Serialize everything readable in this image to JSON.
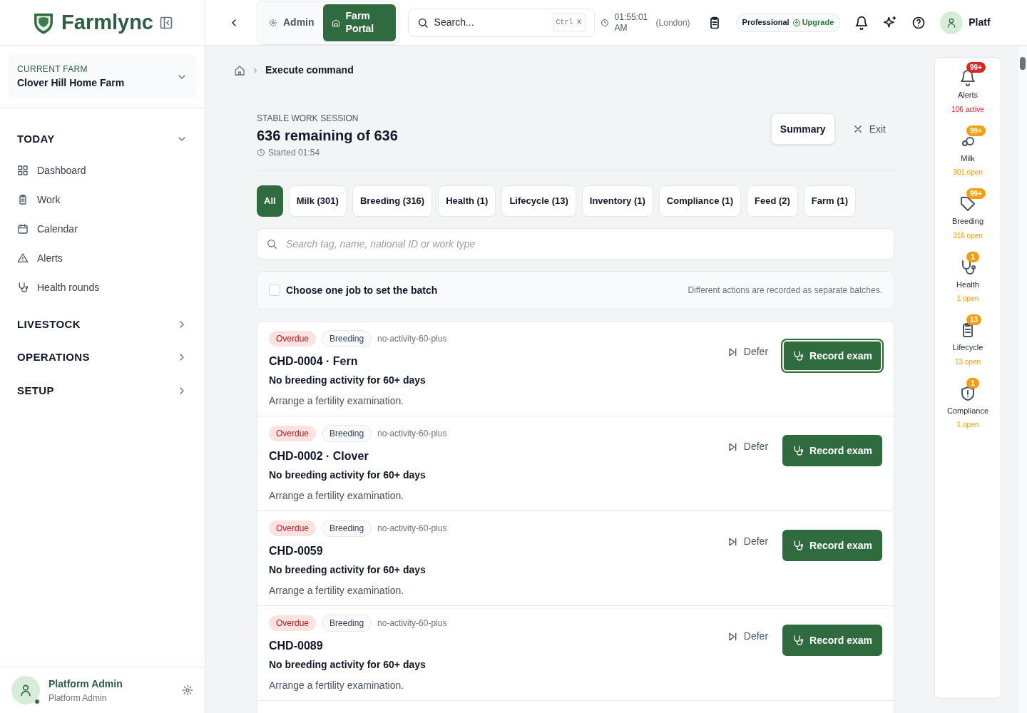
{
  "brand": "Farmlync",
  "portal_switch": [
    {
      "label": "Admin",
      "selected": false
    },
    {
      "label": "Farm Portal",
      "selected": true
    }
  ],
  "search": {
    "placeholder": "Search...",
    "shortcut": "Ctrl K"
  },
  "clock": {
    "time": "01:55:01 AM",
    "zone": "(London)"
  },
  "plan": {
    "name": "Professional",
    "action": "Upgrade"
  },
  "user_name": "Platf",
  "current_farm": {
    "label": "CURRENT FARM",
    "name": "Clover Hill Home Farm"
  },
  "sidebar": {
    "sections": [
      {
        "label": "TODAY",
        "expanded": true,
        "items": [
          "Dashboard",
          "Work",
          "Calendar",
          "Alerts",
          "Health rounds"
        ]
      },
      {
        "label": "LIVESTOCK",
        "expanded": false
      },
      {
        "label": "OPERATIONS",
        "expanded": false
      },
      {
        "label": "SETUP",
        "expanded": false
      }
    ]
  },
  "account": {
    "name": "Platform Admin",
    "role": "Platform Admin",
    "online": true
  },
  "breadcrumb": "Execute command",
  "session": {
    "label": "STABLE WORK SESSION",
    "title": "636 remaining of 636",
    "started": "Started 01:54",
    "summary": "Summary",
    "exit": "Exit"
  },
  "filters": [
    {
      "label": "All",
      "selected": true
    },
    {
      "label": "Milk (301)",
      "selected": false
    },
    {
      "label": "Breeding (316)",
      "selected": false
    },
    {
      "label": "Health (1)",
      "selected": false
    },
    {
      "label": "Lifecycle (13)",
      "selected": false
    },
    {
      "label": "Inventory (1)",
      "selected": false
    },
    {
      "label": "Compliance (1)",
      "selected": false
    },
    {
      "label": "Feed (2)",
      "selected": false
    },
    {
      "label": "Farm (1)",
      "selected": false
    }
  ],
  "job_search": {
    "placeholder": "Search tag, name, national ID or work type"
  },
  "batch": {
    "label": "Choose one job to set the batch",
    "checked": false,
    "note": "Different actions are recorded as separate batches."
  },
  "jobs": [
    {
      "status": "Overdue",
      "category": "Breeding",
      "code": "no-activity-60-plus",
      "animal": "CHD-0004 · Fern",
      "title": "No breeding activity for 60+ days",
      "advice": "Arrange a fertility examination.",
      "defer": "Defer",
      "action": "Record exam",
      "focused": true
    },
    {
      "status": "Overdue",
      "category": "Breeding",
      "code": "no-activity-60-plus",
      "animal": "CHD-0002 · Clover",
      "title": "No breeding activity for 60+ days",
      "advice": "Arrange a fertility examination.",
      "defer": "Defer",
      "action": "Record exam",
      "focused": false
    },
    {
      "status": "Overdue",
      "category": "Breeding",
      "code": "no-activity-60-plus",
      "animal": "CHD-0059",
      "title": "No breeding activity for 60+ days",
      "advice": "Arrange a fertility examination.",
      "defer": "Defer",
      "action": "Record exam",
      "focused": false
    },
    {
      "status": "Overdue",
      "category": "Breeding",
      "code": "no-activity-60-plus",
      "animal": "CHD-0089",
      "title": "No breeding activity for 60+ days",
      "advice": "Arrange a fertility examination.",
      "defer": "Defer",
      "action": "Record exam",
      "focused": false
    }
  ],
  "rail": [
    {
      "label": "Alerts",
      "badge": "99+",
      "sub": "106 active",
      "color": "#dc2626"
    },
    {
      "label": "Milk",
      "badge": "99+",
      "sub": "301 open",
      "color": "#f59e0b"
    },
    {
      "label": "Breeding",
      "badge": "99+",
      "sub": "316 open",
      "color": "#f59e0b"
    },
    {
      "label": "Health",
      "badge": "1",
      "sub": "1 open",
      "color": "#f59e0b"
    },
    {
      "label": "Lifecycle",
      "badge": "13",
      "sub": "13 open",
      "color": "#f59e0b"
    },
    {
      "label": "Compliance",
      "badge": "1",
      "sub": "1 open",
      "color": "#f59e0b"
    }
  ]
}
